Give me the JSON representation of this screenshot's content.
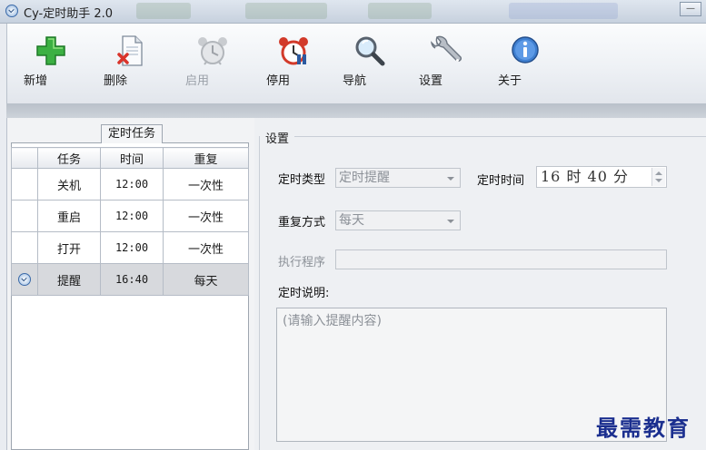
{
  "window": {
    "title": "Cy-定时助手 2.0"
  },
  "toolbar": {
    "buttons": [
      {
        "label": "新增",
        "icon": "add-icon",
        "enabled": true
      },
      {
        "label": "删除",
        "icon": "delete-icon",
        "enabled": true
      },
      {
        "label": "启用",
        "icon": "enable-alarm-icon",
        "enabled": false
      },
      {
        "label": "停用",
        "icon": "disable-alarm-icon",
        "enabled": true
      },
      {
        "label": "导航",
        "icon": "magnifier-icon",
        "enabled": true
      },
      {
        "label": "设置",
        "icon": "wrench-icon",
        "enabled": true
      },
      {
        "label": "关于",
        "icon": "info-icon",
        "enabled": true
      }
    ]
  },
  "task_panel": {
    "title": "定时任务",
    "columns": [
      "任务",
      "时间",
      "重复"
    ],
    "rows": [
      {
        "task": "关机",
        "time": "12:00",
        "repeat": "一次性",
        "selected": false
      },
      {
        "task": "重启",
        "time": "12:00",
        "repeat": "一次性",
        "selected": false
      },
      {
        "task": "打开",
        "time": "12:00",
        "repeat": "一次性",
        "selected": false
      },
      {
        "task": "提醒",
        "time": "16:40",
        "repeat": "每天",
        "selected": true
      }
    ]
  },
  "settings": {
    "title": "设置",
    "type_label": "定时类型",
    "type_value": "定时提醒",
    "time_label": "定时时间",
    "time_value": "16 时 40 分",
    "repeat_label": "重复方式",
    "repeat_value": "每天",
    "program_label": "执行程序",
    "program_value": "",
    "desc_label": "定时说明:",
    "desc_placeholder": "(请输入提醒内容)"
  },
  "watermark": "最需教育",
  "colors": {
    "watermark": "#1b2f8f",
    "disabled_text": "#8c9198",
    "selected_row": "#d7d9dd",
    "add_icon": "#3cb043",
    "delete_icon": "#d9342b"
  }
}
